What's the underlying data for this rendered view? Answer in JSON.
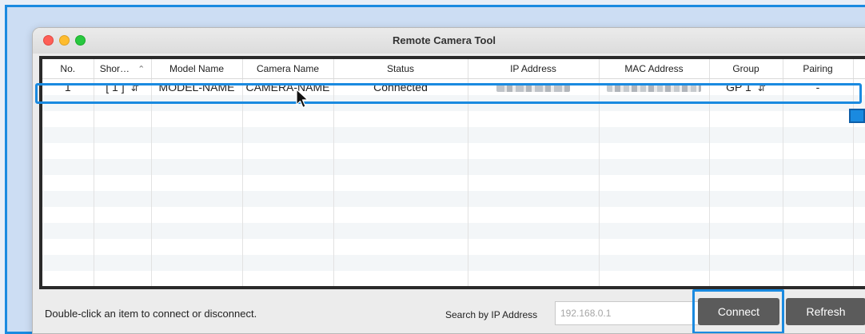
{
  "window": {
    "title": "Remote Camera Tool"
  },
  "table": {
    "headers": {
      "no": "No.",
      "short": "Shor…",
      "short_sort": "⌃",
      "model": "Model Name",
      "camera": "Camera Name",
      "status": "Status",
      "ip": "IP Address",
      "mac": "MAC Address",
      "group": "Group",
      "pairing": "Pairing"
    },
    "rows": [
      {
        "no": "1",
        "short": "[ 1 ]",
        "model": "MODEL-NAME",
        "camera": "CAMERA-NAME",
        "status": "Connected",
        "group": "GP 1",
        "pairing": "-"
      }
    ]
  },
  "footer": {
    "hint": "Double-click an item to connect or disconnect.",
    "search_label": "Search by IP Address",
    "search_placeholder": "192.168.0.1",
    "connect": "Connect",
    "refresh": "Refresh"
  },
  "colors": {
    "highlight": "#1a8ae0",
    "button_bg": "#5b5b5b"
  }
}
